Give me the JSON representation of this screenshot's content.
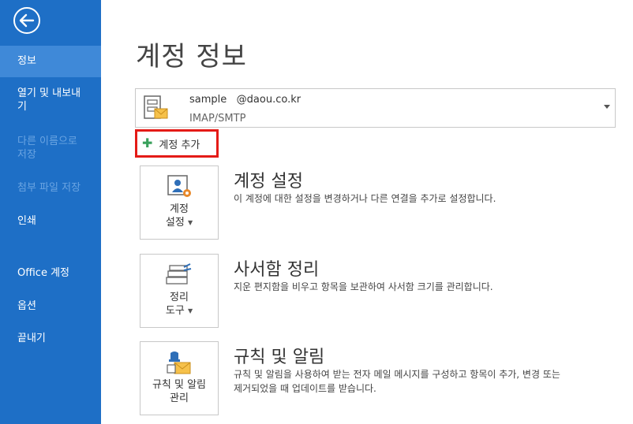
{
  "sidebar": {
    "items": [
      {
        "label": "정보"
      },
      {
        "label": "열기 및 내보내기"
      },
      {
        "label": "다른 이름으로 저장"
      },
      {
        "label": "첨부 파일 저장"
      },
      {
        "label": "인쇄"
      },
      {
        "label": "Office 계정"
      },
      {
        "label": "옵션"
      },
      {
        "label": "끝내기"
      }
    ]
  },
  "main": {
    "title": "계정 정보",
    "account": {
      "email": "sample   @daou.co.kr",
      "type": "IMAP/SMTP"
    },
    "add_account_label": "계정 추가",
    "sections": [
      {
        "tile_line1": "계정",
        "tile_line2": "설정",
        "title": "계정 설정",
        "desc": "이 계정에 대한 설정을 변경하거나 다른 연결을 추가로 설정합니다."
      },
      {
        "tile_line1": "정리",
        "tile_line2": "도구",
        "title": "사서함 정리",
        "desc": "지운 편지함을 비우고 항목을 보관하여 사서함 크기를 관리합니다."
      },
      {
        "tile_line1": "규칙 및 알림",
        "tile_line2": "관리",
        "title": "규칙 및 알림",
        "desc": "규칙 및 알림을 사용하여 받는 전자 메일 메시지를 구성하고 항목이 추가, 변경 또는 제거되었을 때 업데이트를 받습니다."
      }
    ]
  },
  "colors": {
    "sidebar": "#1e6fc6",
    "sidebar_active": "#3f89d8",
    "highlight_box": "#e41b17"
  }
}
